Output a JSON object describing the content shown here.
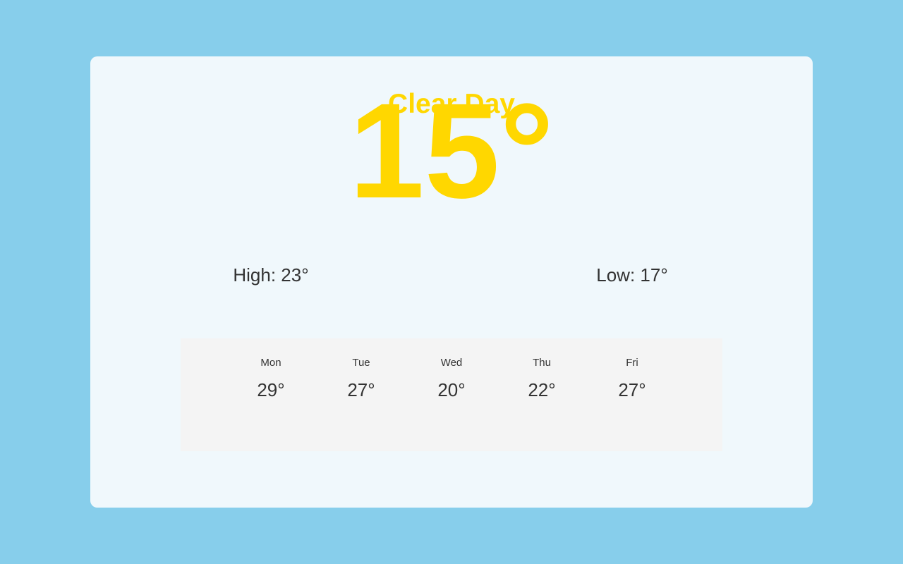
{
  "current": {
    "condition": "Clear Day",
    "temperature": "15°",
    "high": "High: 23°",
    "low": "Low: 17°"
  },
  "forecast": [
    {
      "day": "Mon",
      "temp": "29°"
    },
    {
      "day": "Tue",
      "temp": "27°"
    },
    {
      "day": "Wed",
      "temp": "20°"
    },
    {
      "day": "Thu",
      "temp": "22°"
    },
    {
      "day": "Fri",
      "temp": "27°"
    }
  ],
  "colors": {
    "background": "#87ceeb",
    "card": "#f0f8fc",
    "accent": "#ffd700",
    "text": "#333333",
    "forecast_panel": "#f4f4f4"
  }
}
